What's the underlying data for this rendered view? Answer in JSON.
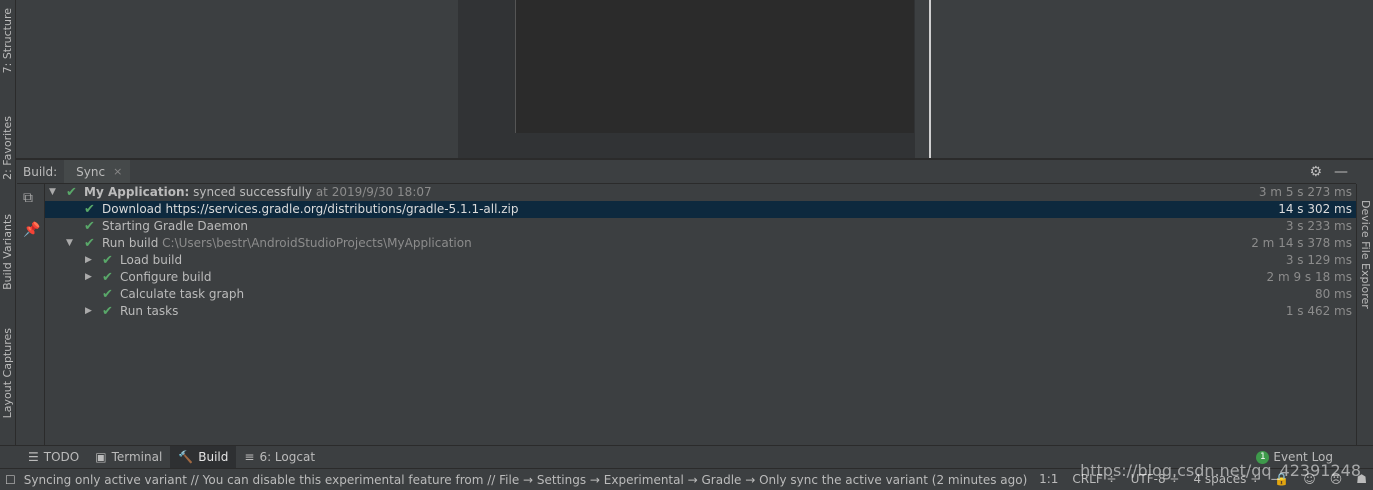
{
  "left_strip": {
    "structure": "7: Structure",
    "favorites": "2: Favorites",
    "build_variants": "Build Variants",
    "layout_captures": "Layout Captures"
  },
  "right_strip": {
    "device_file_explorer": "Device File Explorer"
  },
  "build_panel": {
    "label": "Build:",
    "tab": "Sync",
    "tab_close": "×"
  },
  "tree": [
    {
      "bold": "My Application:",
      "text": " synced successfully",
      "extra": " at 2019/9/30 18:07",
      "time": "3 m 5 s 273 ms"
    },
    {
      "text": "Download https://services.gradle.org/distributions/gradle-5.1.1-all.zip",
      "time": "14 s 302 ms"
    },
    {
      "text": "Starting Gradle Daemon",
      "time": "3 s 233 ms"
    },
    {
      "text": "Run build",
      "extra": " C:\\Users\\bestr\\AndroidStudioProjects\\MyApplication",
      "time": "2 m 14 s 378 ms"
    },
    {
      "text": "Load build",
      "time": "3 s 129 ms"
    },
    {
      "text": "Configure build",
      "time": "2 m 9 s 18 ms"
    },
    {
      "text": "Calculate task graph",
      "time": "80 ms"
    },
    {
      "text": "Run tasks",
      "time": "1 s 462 ms"
    }
  ],
  "bottom_tabs": {
    "todo": "TODO",
    "terminal": "Terminal",
    "build": "Build",
    "logcat": "6: Logcat",
    "event_log": "Event Log",
    "event_count": "1"
  },
  "status": {
    "message": "Syncing only active variant // You can disable this experimental feature from // File → Settings → Experimental → Gradle → Only sync the active variant (2 minutes ago)",
    "position": "1:1",
    "line_sep": "CRLF ÷",
    "encoding": "UTF-8 ÷",
    "indent": "4 spaces ÷"
  },
  "watermark": "https://blog.csdn.net/qq_42391248"
}
